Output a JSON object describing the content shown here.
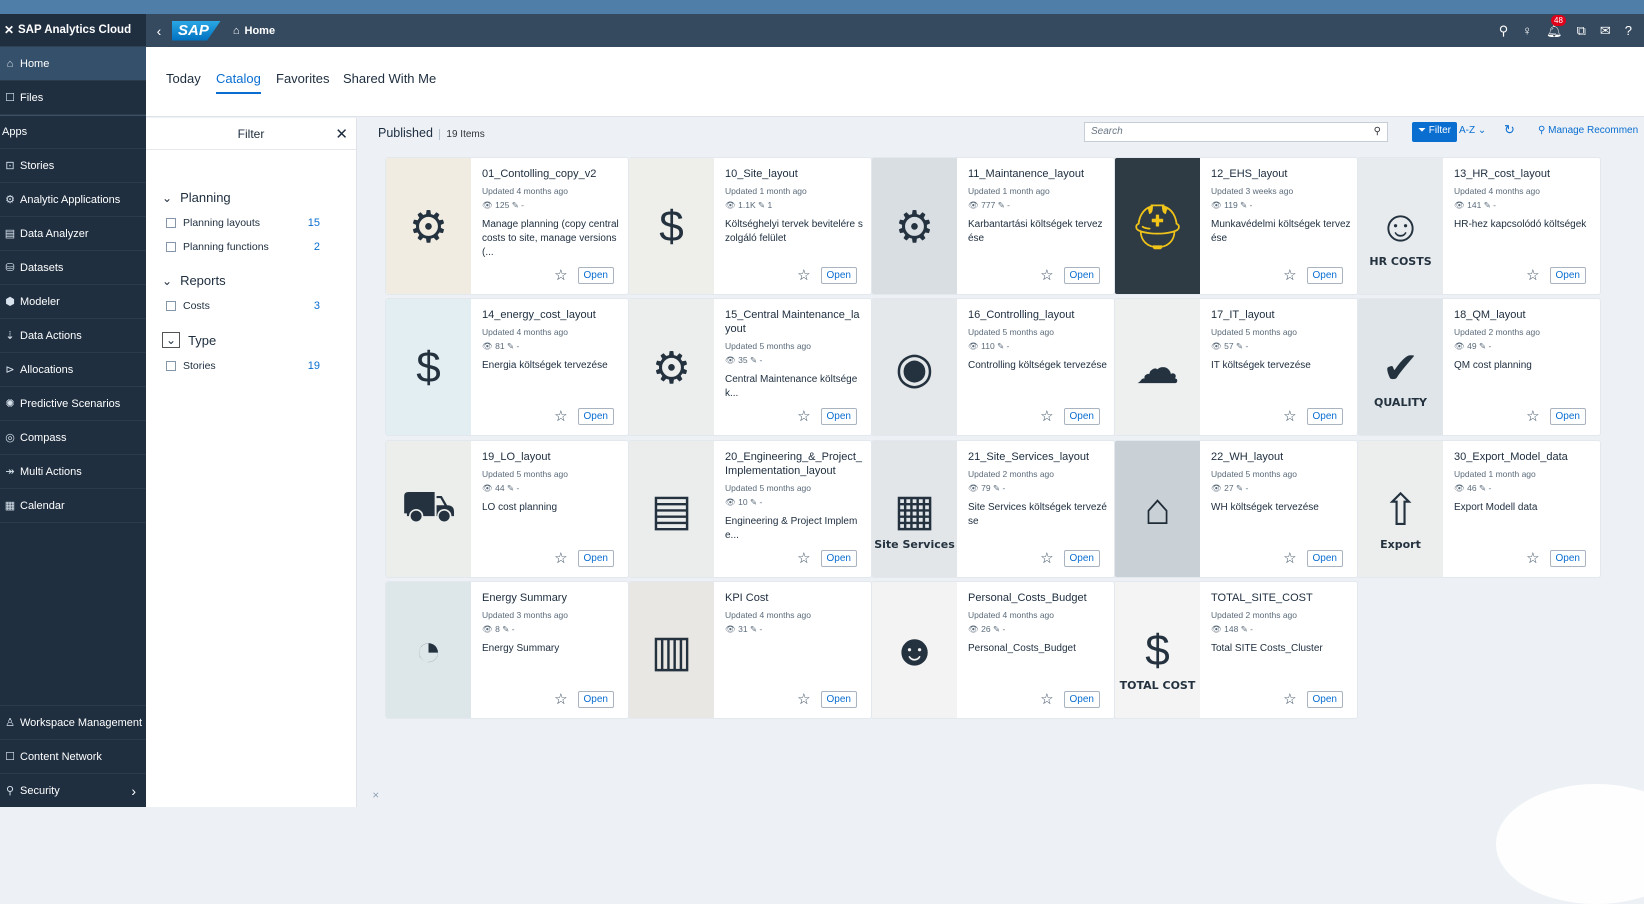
{
  "app": {
    "title": "SAP Analytics Cloud"
  },
  "topbar": {
    "logo": "SAP",
    "breadcrumb": "Home",
    "notification_count": "48"
  },
  "sidebar": {
    "items": [
      {
        "label": "Home",
        "icon": "home-icon",
        "glyph": "⌂"
      },
      {
        "label": "Files",
        "icon": "file-icon",
        "glyph": "☐"
      }
    ],
    "apps_label": "Apps",
    "apps": [
      {
        "label": "Stories",
        "icon": "story-icon",
        "glyph": "⊡"
      },
      {
        "label": "Analytic Applications",
        "icon": "analytic-app-icon",
        "glyph": "⚙"
      },
      {
        "label": "Data Analyzer",
        "icon": "data-analyzer-icon",
        "glyph": "▤"
      },
      {
        "label": "Datasets",
        "icon": "dataset-icon",
        "glyph": "⛁"
      },
      {
        "label": "Modeler",
        "icon": "modeler-icon",
        "glyph": "⬢"
      },
      {
        "label": "Data Actions",
        "icon": "data-actions-icon",
        "glyph": "⇣"
      },
      {
        "label": "Allocations",
        "icon": "allocations-icon",
        "glyph": "⊳"
      },
      {
        "label": "Predictive Scenarios",
        "icon": "predictive-icon",
        "glyph": "✺"
      },
      {
        "label": "Compass",
        "icon": "compass-icon",
        "glyph": "◎"
      },
      {
        "label": "Multi Actions",
        "icon": "multi-actions-icon",
        "glyph": "↠"
      },
      {
        "label": "Calendar",
        "icon": "calendar-icon",
        "glyph": "▦"
      }
    ],
    "bottom": [
      {
        "label": "Workspace Management",
        "icon": "workspace-icon",
        "glyph": "♙"
      },
      {
        "label": "Content Network",
        "icon": "content-network-icon",
        "glyph": "☐"
      },
      {
        "label": "Security",
        "icon": "security-icon",
        "glyph": "⚲"
      }
    ]
  },
  "tabs": [
    {
      "label": "Today"
    },
    {
      "label": "Catalog"
    },
    {
      "label": "Favorites"
    },
    {
      "label": "Shared With Me"
    }
  ],
  "filter": {
    "title": "Filter",
    "sections": [
      {
        "label": "Planning",
        "rows": [
          {
            "label": "Planning layouts",
            "count": "15"
          },
          {
            "label": "Planning functions",
            "count": "2"
          }
        ]
      },
      {
        "label": "Reports",
        "rows": [
          {
            "label": "Costs",
            "count": "3"
          }
        ]
      },
      {
        "label": "Type",
        "rows": [
          {
            "label": "Stories",
            "count": "19"
          }
        ]
      }
    ]
  },
  "main": {
    "published_label": "Published",
    "count_label": "19 Items",
    "search_placeholder": "Search",
    "filter_button": "Filter",
    "sort_label": "A-Z ⌄",
    "manage_label": "Manage Recommen"
  },
  "cards": [
    {
      "title": "01_Contolling_copy_v2",
      "updated": "Updated 4 months ago",
      "stats": "👁 125 ✎ -",
      "desc": "Manage planning (copy central costs to site, manage versions (...",
      "glyph": "⚙",
      "icon": "gear-chart-icon",
      "bg": "#f1ece2",
      "cap": ""
    },
    {
      "title": "10_Site_layout",
      "updated": "Updated 1 month ago",
      "stats": "👁 1.1K ✎ 1",
      "desc": "Költséghelyi tervek bevitelére szolgáló felület",
      "glyph": "$",
      "icon": "dollar-icon",
      "bg": "#eeeeea",
      "cap": ""
    },
    {
      "title": "11_Maintanence_layout",
      "updated": "Updated 1 month ago",
      "stats": "👁 777 ✎ -",
      "desc": "Karbantartási költségek tervezése",
      "glyph": "⚙",
      "icon": "wrench-gear-icon",
      "bg": "#d9dee3",
      "cap": ""
    },
    {
      "title": "12_EHS_layout",
      "updated": "Updated 3 weeks ago",
      "stats": "👁 119 ✎ -",
      "desc": "Munkavédelmi költségek tervezése",
      "glyph": "⛑",
      "icon": "helmet-icon",
      "bg": "#2e3a44",
      "cap": ""
    },
    {
      "title": "13_HR_cost_layout",
      "updated": "Updated 4 months ago",
      "stats": "👁 141 ✎ -",
      "desc": "HR-hez kapcsolódó költségek",
      "glyph": "☺",
      "icon": "hr-icon",
      "bg": "#e7ebee",
      "cap": "HR COSTS"
    },
    {
      "title": "14_energy_cost_layout",
      "updated": "Updated 4 months ago",
      "stats": "👁 81 ✎ -",
      "desc": "Energia költségek tervezése",
      "glyph": "$",
      "icon": "energy-icon",
      "bg": "#e3eef2",
      "cap": ""
    },
    {
      "title": "15_Central Maintenance_layout",
      "updated": "Updated 5 months ago",
      "stats": "👁 35 ✎ -",
      "desc": "Central Maintenance költségek...",
      "glyph": "⚙",
      "icon": "network-gear-icon",
      "bg": "#eceeee",
      "cap": ""
    },
    {
      "title": "16_Controlling_layout",
      "updated": "Updated 5 months ago",
      "stats": "👁 110 ✎ -",
      "desc": "Controlling költségek tervezése",
      "glyph": "◉",
      "icon": "magnifier-chart-icon",
      "bg": "#e5e8ea",
      "cap": ""
    },
    {
      "title": "17_IT_layout",
      "updated": "Updated 5 months ago",
      "stats": "👁 57 ✎ -",
      "desc": "IT költségek tervezése",
      "glyph": "☁",
      "icon": "cloud-icon",
      "bg": "#eef0f0",
      "cap": ""
    },
    {
      "title": "18_QM_layout",
      "updated": "Updated 2 months ago",
      "stats": "👁 49 ✎ -",
      "desc": "QM cost planning",
      "glyph": "✔",
      "icon": "quality-icon",
      "bg": "#dfe5e8",
      "cap": "QUALITY"
    },
    {
      "title": "19_LO_layout",
      "updated": "Updated 5 months ago",
      "stats": "👁 44 ✎ -",
      "desc": "LO cost planning",
      "glyph": "⛟",
      "icon": "truck-icon",
      "bg": "#eceeec",
      "cap": ""
    },
    {
      "title": "20_Engineering_&_Project_Implementation_layout",
      "updated": "Updated 5 months ago",
      "stats": "👁 10 ✎ -",
      "desc": "Engineering & Project Impleme...",
      "glyph": "▤",
      "icon": "blueprint-icon",
      "bg": "#ebedec",
      "cap": ""
    },
    {
      "title": "21_Site_Services_layout",
      "updated": "Updated 2 months ago",
      "stats": "👁 79 ✎ -",
      "desc": "Site Services költségek tervezése",
      "glyph": "▦",
      "icon": "building-icon",
      "bg": "#e2e6e9",
      "cap": "Site Services"
    },
    {
      "title": "22_WH_layout",
      "updated": "Updated 5 months ago",
      "stats": "👁 27 ✎ -",
      "desc": "WH költségek tervezése",
      "glyph": "⌂",
      "icon": "warehouse-icon",
      "bg": "#c9d0d6",
      "cap": ""
    },
    {
      "title": "30_Export_Model_data",
      "updated": "Updated 1 month ago",
      "stats": "👁 46 ✎ -",
      "desc": "Export Modell data",
      "glyph": "⇧",
      "icon": "export-box-icon",
      "bg": "#eceeee",
      "cap": "Export"
    },
    {
      "title": "Energy Summary",
      "updated": "Updated 3 months ago",
      "stats": "👁 8 ✎ -",
      "desc": "Energy Summary",
      "glyph": "◔",
      "icon": "gauge-icon",
      "bg": "#dde6e9",
      "cap": ""
    },
    {
      "title": "KPI Cost",
      "updated": "Updated 4 months ago",
      "stats": "👁 31 ✎ -",
      "desc": "",
      "glyph": "▥",
      "icon": "kpi-chart-icon",
      "bg": "#e9e7e3",
      "cap": ""
    },
    {
      "title": "Personal_Costs_Budget",
      "updated": "Updated 4 months ago",
      "stats": "👁 26 ✎ -",
      "desc": "Personal_Costs_Budget",
      "glyph": "☻",
      "icon": "person-money-icon",
      "bg": "#f3f3f3",
      "cap": ""
    },
    {
      "title": "TOTAL_SITE_COST",
      "updated": "Updated 2 months ago",
      "stats": "👁 148 ✎ -",
      "desc": "Total SITE Costs_Cluster",
      "glyph": "$",
      "icon": "calculator-icon",
      "bg": "#f4f4f4",
      "cap": "TOTAL COST"
    }
  ],
  "card_open_label": "Open",
  "colors": {
    "shell": "#354a5f",
    "sidebar": "#1f2f40",
    "accent": "#0a6ed1"
  }
}
